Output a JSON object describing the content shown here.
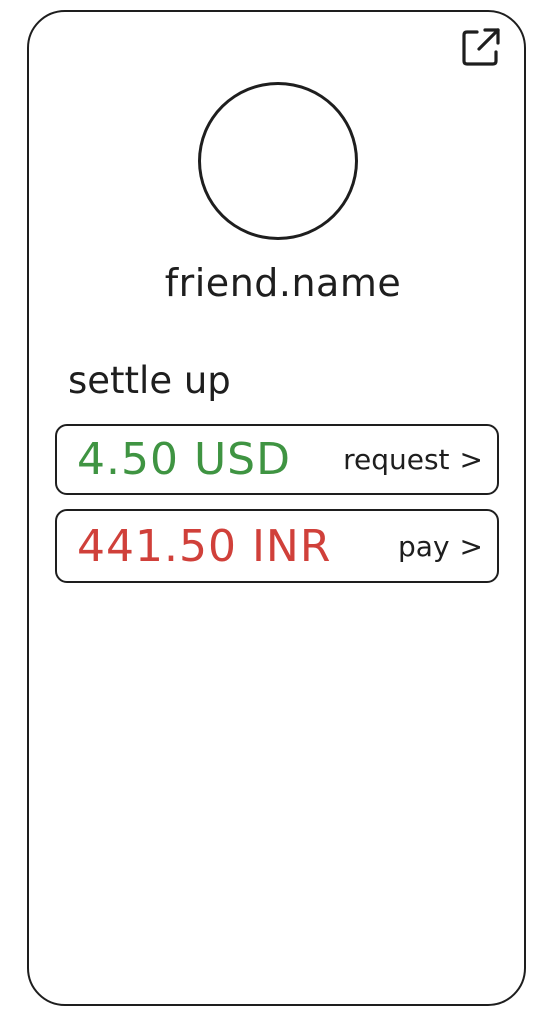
{
  "profile": {
    "name": "friend.name"
  },
  "settle": {
    "title": "settle up",
    "items": [
      {
        "amount": "4.50 USD",
        "action": "request",
        "color": "#3f9442"
      },
      {
        "amount": "441.50 INR",
        "action": "pay",
        "color": "#d0403a"
      }
    ],
    "chevron": ">"
  },
  "icons": {
    "external_link": "external-link-icon",
    "chevron": "chevron-right-icon"
  }
}
